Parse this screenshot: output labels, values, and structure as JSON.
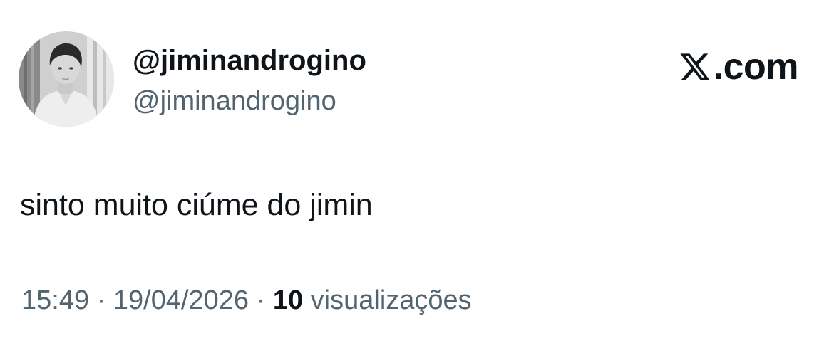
{
  "author": {
    "display_name": "@jiminandrogino",
    "handle": "@jiminandrogino",
    "avatar_icon": "profile-photo"
  },
  "brand": {
    "logo_icon": "x-logo-icon",
    "text": ".com"
  },
  "tweet": {
    "text": "sinto muito ciúme do jimin"
  },
  "meta": {
    "time": "15:49",
    "separator": " · ",
    "date": "19/04/2026",
    "views_count": "10",
    "views_label": " visualizações"
  },
  "colors": {
    "text_primary": "#0f1419",
    "text_secondary": "#536471",
    "background": "#ffffff"
  }
}
